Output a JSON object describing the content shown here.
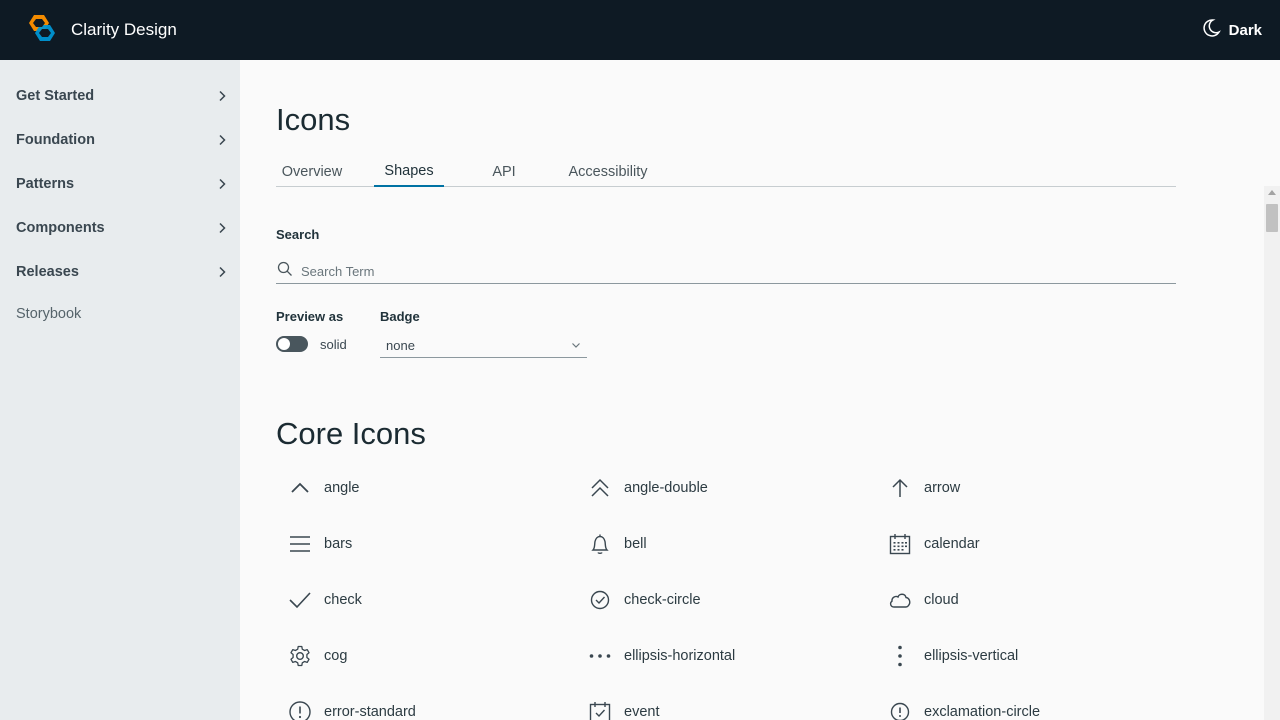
{
  "header": {
    "brand": "Clarity Design",
    "theme_label": "Dark",
    "logo_icon": "clarity-logo",
    "theme_icon": "moon-icon",
    "colors": {
      "bar": "#0e1a24",
      "logo_orange": "#f38b00",
      "logo_blue": "#0095d3"
    }
  },
  "sidebar": {
    "items": [
      {
        "label": "Get Started"
      },
      {
        "label": "Foundation"
      },
      {
        "label": "Patterns"
      },
      {
        "label": "Components"
      },
      {
        "label": "Releases"
      }
    ],
    "link": "Storybook"
  },
  "main": {
    "title": "Icons",
    "tabs": [
      {
        "label": "Overview"
      },
      {
        "label": "Shapes"
      },
      {
        "label": "API"
      },
      {
        "label": "Accessibility"
      }
    ],
    "active_tab": "Shapes",
    "search": {
      "label": "Search",
      "placeholder": "Search Term",
      "value": ""
    },
    "preview": {
      "label": "Preview as",
      "toggle_text": "solid",
      "toggle_on": false
    },
    "badge": {
      "label": "Badge",
      "value": "none"
    },
    "section_title": "Core Icons",
    "icons": [
      {
        "label": "angle",
        "icon": "angle-icon"
      },
      {
        "label": "angle-double",
        "icon": "angle-double-icon"
      },
      {
        "label": "arrow",
        "icon": "arrow-icon"
      },
      {
        "label": "bars",
        "icon": "bars-icon"
      },
      {
        "label": "bell",
        "icon": "bell-icon"
      },
      {
        "label": "calendar",
        "icon": "calendar-icon"
      },
      {
        "label": "check",
        "icon": "check-icon"
      },
      {
        "label": "check-circle",
        "icon": "check-circle-icon"
      },
      {
        "label": "cloud",
        "icon": "cloud-icon"
      },
      {
        "label": "cog",
        "icon": "cog-icon"
      },
      {
        "label": "ellipsis-horizontal",
        "icon": "ellipsis-horizontal-icon"
      },
      {
        "label": "ellipsis-vertical",
        "icon": "ellipsis-vertical-icon"
      },
      {
        "label": "error-standard",
        "icon": "error-standard-icon"
      },
      {
        "label": "event",
        "icon": "event-icon"
      },
      {
        "label": "exclamation-circle",
        "icon": "exclamation-circle-icon"
      }
    ],
    "accent_color": "#0072a3"
  }
}
